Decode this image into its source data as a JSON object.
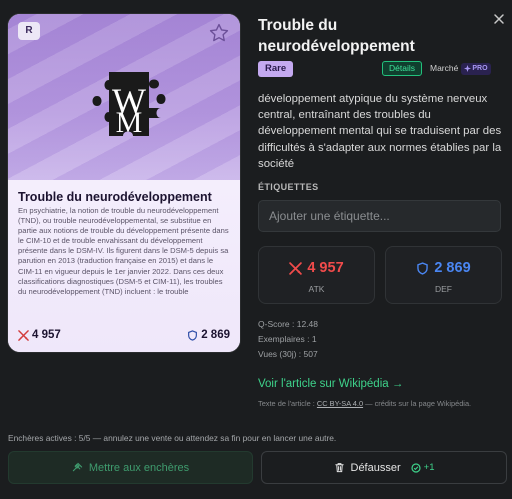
{
  "card": {
    "rarity_letter": "R",
    "title": "Trouble du neurodéveloppement",
    "description": "En psychiatrie, la notion de trouble du neurodéveloppement (TND), ou trouble neurodéveloppemental, se substitue en partie aux notions de trouble du développement présente dans le CIM-10 et de trouble envahissant du développement présente dans le DSM-IV. Ils figurent dans le DSM-5 depuis sa parution en 2013 (traduction française en 2015) et dans le CIM-11 en vigueur depuis le 1er janvier 2022. Dans ces deux classifications diagnostiques (DSM-5 et CIM-11), les troubles du neurodéveloppement (TND) incluent : le trouble",
    "atk": "4 957",
    "def": "2 869"
  },
  "panel": {
    "title": "Trouble du neurodéveloppement",
    "rarity": "Rare",
    "details_label": "Détails",
    "market_label": "Marché",
    "pro_label": "PRO",
    "description": "développement atypique du système nerveux central, entraînant des troubles du développement mental qui se traduisent par des difficultés à s'adapter aux normes établies par la société",
    "tags_heading": "ÉTIQUETTES",
    "tag_placeholder": "Ajouter une étiquette...",
    "atk_value": "4 957",
    "atk_label": "ATK",
    "def_value": "2 869",
    "def_label": "DEF",
    "q_score": "Q-Score : 12.48",
    "copies": "Exemplaires : 1",
    "views": "Vues (30j) : 507",
    "wiki_link": "Voir l'article sur Wikipédia →",
    "license_prefix": "Texte de l'article : ",
    "license_name": "CC BY-SA 4.0",
    "license_suffix": " — crédits sur la page Wikipédia."
  },
  "footer": {
    "auction_note": "Enchères actives : 5/5 — annulez une vente ou attendez sa fin pour en lancer une autre.",
    "auction_button": "Mettre aux enchères",
    "destroy_button": "Défausser",
    "destroy_reward": "+1"
  },
  "colors": {
    "accent_green": "#3ed38b",
    "atk_red": "#f04b4b",
    "def_blue": "#4a86f2",
    "rarity_purple": "#c4a9f0"
  },
  "icons": {
    "favorite": "star-outline-icon",
    "close": "close-icon",
    "atk": "crossed-swords-icon",
    "def": "shield-icon",
    "auction": "gavel-icon",
    "destroy": "trash-icon",
    "reward": "coin-icon",
    "pro": "sparkle-icon"
  }
}
